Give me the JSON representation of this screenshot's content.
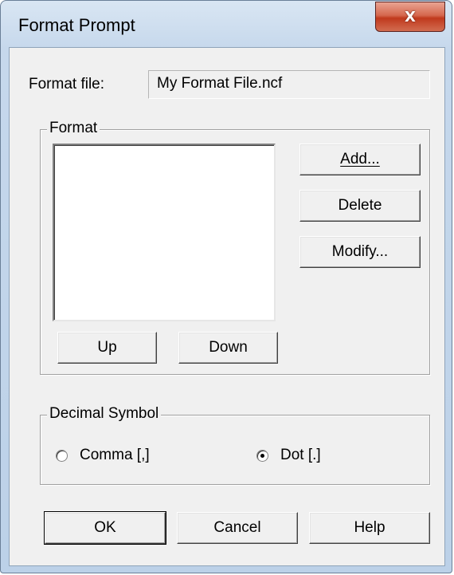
{
  "window": {
    "title": "Format Prompt",
    "close_glyph": "X"
  },
  "format_file": {
    "label": "Format file:",
    "value": "My Format File.ncf"
  },
  "format_group": {
    "legend": "Format",
    "add_label": "Add...",
    "delete_label": "Delete",
    "modify_label": "Modify...",
    "up_label": "Up",
    "down_label": "Down"
  },
  "decimal_group": {
    "legend": "Decimal Symbol",
    "options": [
      {
        "label": "Comma [,]",
        "selected": false
      },
      {
        "label": "Dot [.]",
        "selected": true
      }
    ]
  },
  "footer": {
    "ok_label": "OK",
    "cancel_label": "Cancel",
    "help_label": "Help"
  }
}
